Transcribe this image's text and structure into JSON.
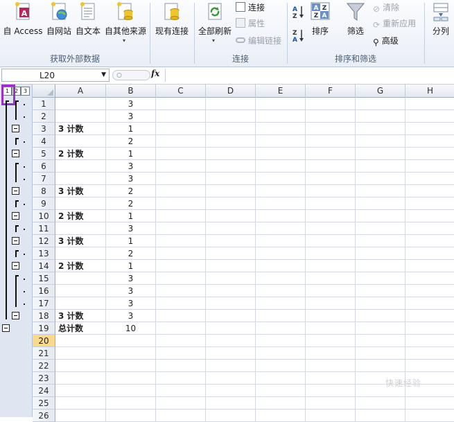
{
  "ribbon": {
    "get_external": {
      "access_label": "自 Access",
      "web_label": "自网站",
      "text_label": "自文本",
      "other_label": "自其他来源",
      "group_label": "获取外部数据"
    },
    "existing_label": "现有连接",
    "connections": {
      "refresh_all_label": "全部刷新",
      "connections_label": "连接",
      "properties_label": "属性",
      "edit_links_label": "编辑链接",
      "group_label": "连接"
    },
    "sort_filter": {
      "sort_label": "排序",
      "filter_label": "筛选",
      "clear_label": "清除",
      "reapply_label": "重新应用",
      "advanced_label": "高级",
      "group_label": "排序和筛选"
    },
    "split_label": "分列"
  },
  "formula_bar": {
    "name_box": "L20",
    "fx_label": "fx",
    "formula": ""
  },
  "outline": {
    "levels": [
      "1",
      "2",
      "3"
    ]
  },
  "columns": [
    "A",
    "B",
    "C",
    "D",
    "E",
    "F",
    "G",
    "H"
  ],
  "rows": [
    {
      "n": "1",
      "a": "",
      "b": "3"
    },
    {
      "n": "2",
      "a": "",
      "b": "3"
    },
    {
      "n": "3",
      "a": "3 计数",
      "b": "1"
    },
    {
      "n": "4",
      "a": "",
      "b": "2"
    },
    {
      "n": "5",
      "a": "2 计数",
      "b": "1"
    },
    {
      "n": "6",
      "a": "",
      "b": "3"
    },
    {
      "n": "7",
      "a": "",
      "b": "3"
    },
    {
      "n": "8",
      "a": "3 计数",
      "b": "2"
    },
    {
      "n": "9",
      "a": "",
      "b": "2"
    },
    {
      "n": "10",
      "a": "2 计数",
      "b": "1"
    },
    {
      "n": "11",
      "a": "",
      "b": "3"
    },
    {
      "n": "12",
      "a": "3 计数",
      "b": "1"
    },
    {
      "n": "13",
      "a": "",
      "b": "2"
    },
    {
      "n": "14",
      "a": "2 计数",
      "b": "1"
    },
    {
      "n": "15",
      "a": "",
      "b": "3"
    },
    {
      "n": "16",
      "a": "",
      "b": "3"
    },
    {
      "n": "17",
      "a": "",
      "b": "3"
    },
    {
      "n": "18",
      "a": "3 计数",
      "b": "3"
    },
    {
      "n": "19",
      "a": "总计数",
      "b": "10"
    },
    {
      "n": "20",
      "a": "",
      "b": ""
    },
    {
      "n": "21",
      "a": "",
      "b": ""
    },
    {
      "n": "22",
      "a": "",
      "b": ""
    },
    {
      "n": "23",
      "a": "",
      "b": ""
    },
    {
      "n": "24",
      "a": "",
      "b": ""
    },
    {
      "n": "25",
      "a": "",
      "b": ""
    },
    {
      "n": "26",
      "a": "",
      "b": ""
    }
  ],
  "active_row": "20",
  "watermark": "快速经验",
  "colors": {
    "selection_outline": "#9b30c9",
    "active_row_header": "#f9d98c"
  }
}
